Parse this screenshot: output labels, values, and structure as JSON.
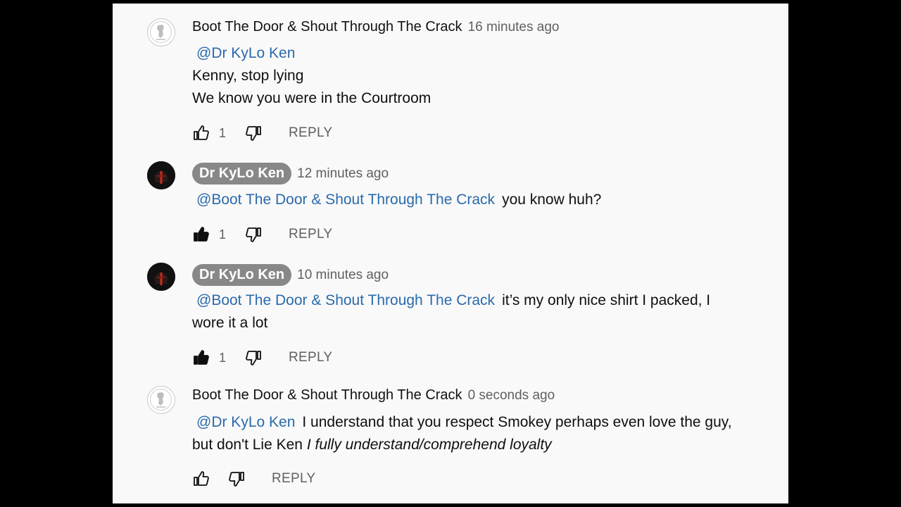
{
  "comments": [
    {
      "author": "Boot The Door & Shout Through The Crack",
      "time": "16 minutes ago",
      "mention": "@Dr KyLo Ken",
      "lines": [
        "Kenny, stop lying",
        "We know you were in the Courtroom"
      ],
      "likes": "1",
      "liked": false,
      "reply": "REPLY"
    },
    {
      "author": "Dr KyLo Ken",
      "time": "12 minutes ago",
      "mention": "@Boot The Door & Shout Through The Crack",
      "text": "you know huh?",
      "likes": "1",
      "liked": true,
      "reply": "REPLY"
    },
    {
      "author": "Dr KyLo Ken",
      "time": "10 minutes ago",
      "mention": "@Boot The Door & Shout Through The Crack",
      "text": "it’s my only nice shirt I packed, I",
      "text2": "wore it a lot",
      "likes": "1",
      "liked": true,
      "reply": "REPLY"
    },
    {
      "author": "Boot The Door & Shout Through The Crack",
      "time": "0 seconds ago",
      "mention": "@Dr KyLo Ken",
      "text": "I understand that you respect Smokey perhaps even love the guy,",
      "text2": "but don't Lie Ken",
      "text2_italic": "I fully understand/comprehend loyalty",
      "likes": "",
      "liked": false,
      "reply": "REPLY"
    }
  ],
  "colors": {
    "mention": "#2a6aac",
    "author_chip_bg": "#888888",
    "meta_text": "#606060",
    "panel_bg": "#f9f9f9"
  },
  "icons": [
    "avatar-seal-icon",
    "avatar-helmet-icon",
    "thumbs-up-icon",
    "thumbs-down-icon"
  ]
}
